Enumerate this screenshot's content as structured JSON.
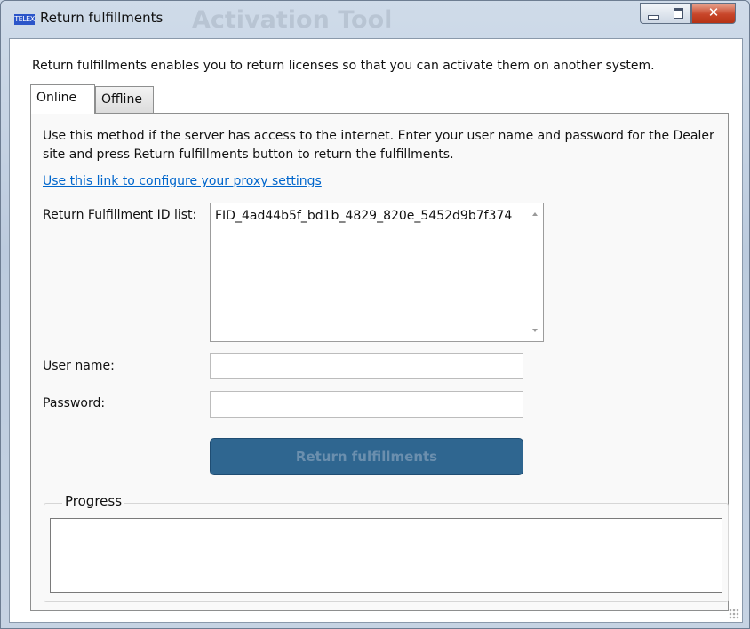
{
  "window": {
    "title": "Return fulfillments",
    "app_icon_text": "TELEX",
    "background_title": "Activation Tool",
    "accent_color": "#2f6690",
    "link_color": "#0066cc"
  },
  "description": "Return fulfillments enables you to return licenses so that you can activate them on another system.",
  "tabs": [
    {
      "label": "Online",
      "selected": true
    },
    {
      "label": "Offline",
      "selected": false
    }
  ],
  "online": {
    "instructions": "Use this method if the server has access to the internet. Enter your user name and password for the Dealer site and press Return fulfillments button to return the fulfillments.",
    "proxy_link": "Use this link to configure your proxy settings",
    "id_list_label": "Return Fulfillment ID list:",
    "id_list_value": "FID_4ad44b5f_bd1b_4829_820e_5452d9b7f374",
    "username_label": "User name:",
    "username_value": "",
    "password_label": "Password:",
    "password_value": "",
    "return_button_label": "Return fulfillments",
    "return_button_enabled": false
  },
  "progress": {
    "label": "Progress",
    "text": ""
  }
}
